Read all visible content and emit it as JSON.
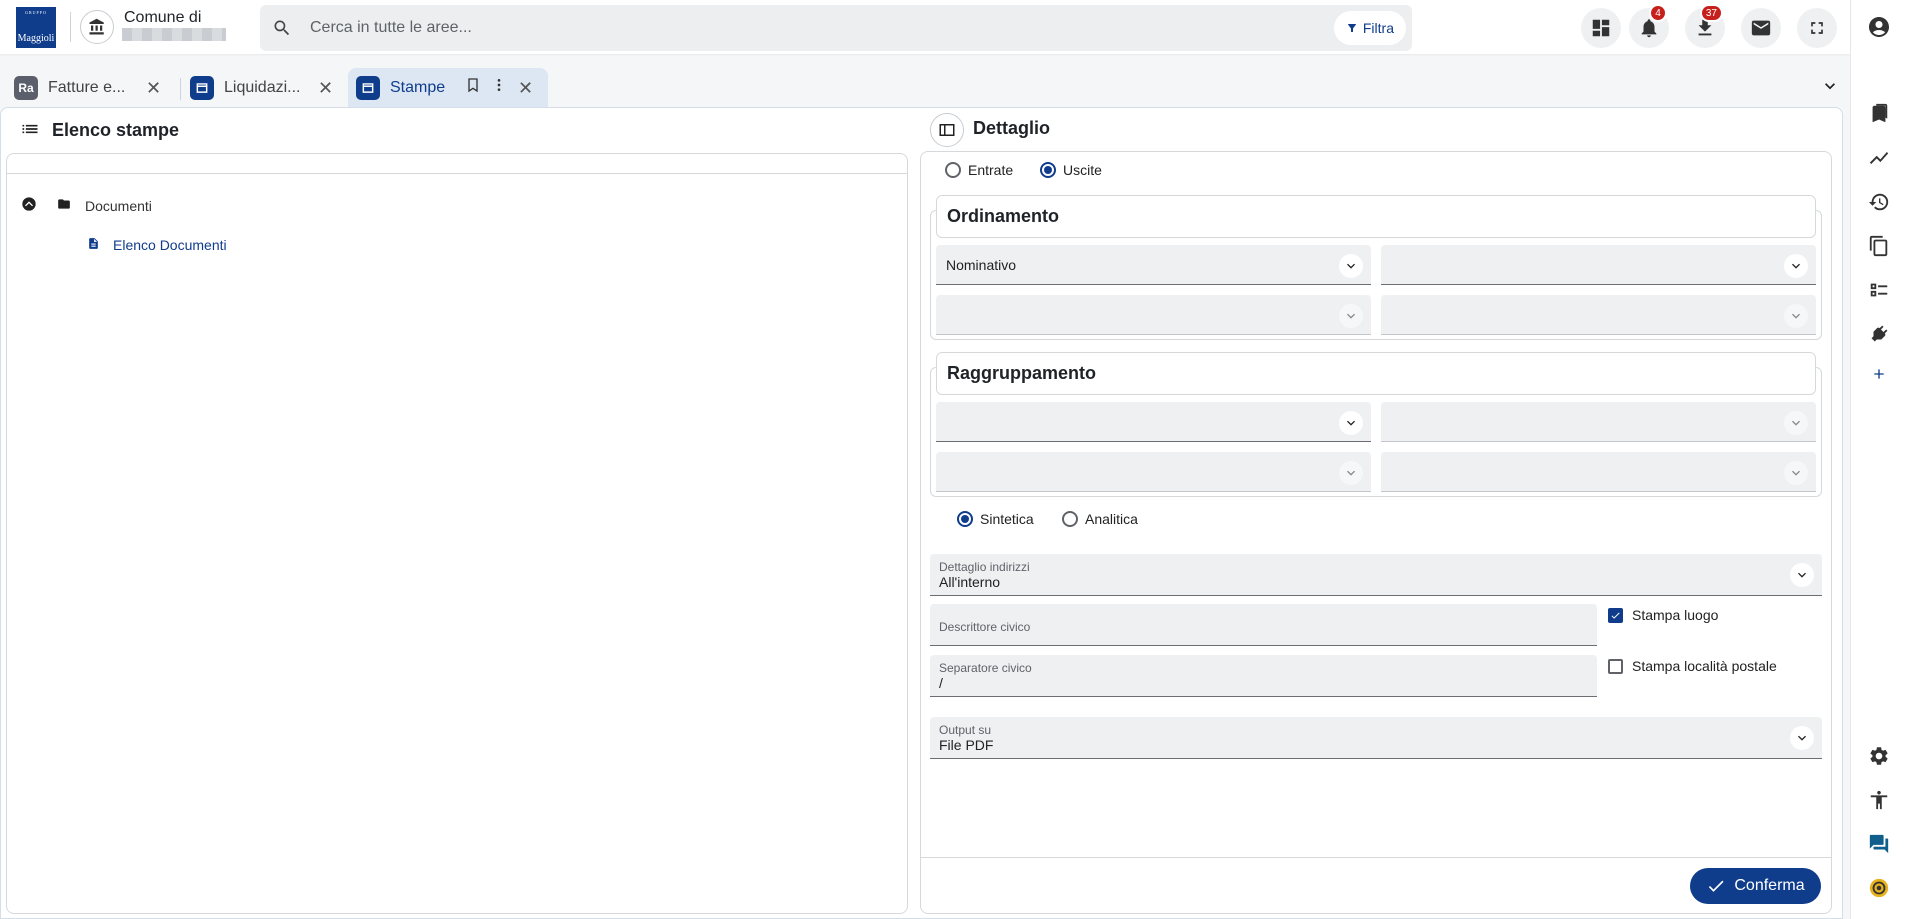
{
  "brand": {
    "logo_text": "Maggioli",
    "logo_small": "GRUPPO"
  },
  "ente": {
    "title": "Comune di"
  },
  "search": {
    "placeholder": "Cerca in tutte le aree...",
    "filter_label": "Filtra"
  },
  "toolbar": {
    "notifications_count": "4",
    "downloads_count": "37"
  },
  "tabs": [
    {
      "label": "Fatture e...",
      "icon_text": "Ra"
    },
    {
      "label": "Liquidazi..."
    },
    {
      "label": "Stampe"
    }
  ],
  "left_panel": {
    "title": "Elenco stampe",
    "tree": {
      "folder": "Documenti",
      "item": "Elenco Documenti"
    }
  },
  "right_panel": {
    "title": "Dettaglio",
    "tipo": {
      "options": [
        "Entrate",
        "Uscite"
      ],
      "selected": "Uscite"
    },
    "ordinamento": {
      "title": "Ordinamento",
      "field1": "Nominativo"
    },
    "raggruppamento": {
      "title": "Raggruppamento"
    },
    "modalita": {
      "options": [
        "Sintetica",
        "Analitica"
      ],
      "selected": "Sintetica"
    },
    "dettaglio_indirizzi": {
      "label": "Dettaglio indirizzi",
      "value": "All'interno"
    },
    "descrittore_civico": {
      "label": "Descrittore civico",
      "value": ""
    },
    "separatore_civico": {
      "label": "Separatore civico",
      "value": "/"
    },
    "stampa_luogo": {
      "label": "Stampa luogo",
      "checked": true
    },
    "stampa_localita": {
      "label": "Stampa località postale",
      "checked": false
    },
    "output": {
      "label": "Output su",
      "value": "File PDF"
    },
    "confirm_label": "Conferma"
  },
  "colors": {
    "primary": "#0f3d8c",
    "badge": "#c6201d",
    "field_bg": "#eef0f2"
  }
}
